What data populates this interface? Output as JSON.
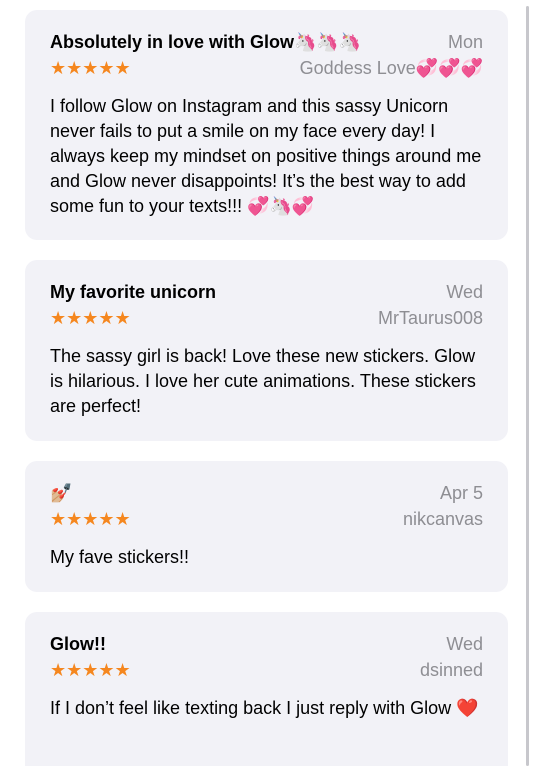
{
  "reviews": [
    {
      "title": "Absolutely in love with Glow🦄🦄🦄",
      "date": "Mon",
      "stars": "★★★★★",
      "reviewer": "Goddess Love💞💞💞",
      "body": "I follow Glow on Instagram and this sassy Unicorn never fails to put a smile on my face every day! I always keep my mindset on positive things around me and Glow never disappoints! It’s the best way to add some fun to your texts!!! 💞🦄💞"
    },
    {
      "title": "My favorite unicorn",
      "date": "Wed",
      "stars": "★★★★★",
      "reviewer": "MrTaurus008",
      "body": "The sassy girl is back! Love these new stickers. Glow is hilarious. I love her cute animations. These stickers are perfect!"
    },
    {
      "title": "💅🏼",
      "date": "Apr 5",
      "stars": "★★★★★",
      "reviewer": "nikcanvas",
      "body": "My fave stickers!!"
    },
    {
      "title": "Glow!!",
      "date": "Wed",
      "stars": "★★★★★",
      "reviewer": "dsinned",
      "body": "If I don’t feel like texting back I just reply with Glow ❤️"
    }
  ],
  "colors": {
    "card_background": "#f2f2f7",
    "star": "#f5871f",
    "secondary_text": "#8e8e93"
  }
}
